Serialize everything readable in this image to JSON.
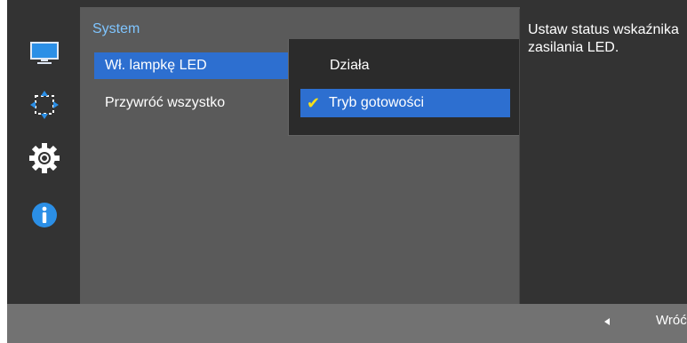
{
  "panel": {
    "title": "System",
    "items": [
      {
        "label": "Wł. lampkę LED",
        "selected": true
      },
      {
        "label": "Przywróć wszystko",
        "selected": false
      }
    ]
  },
  "submenu": {
    "options": [
      {
        "label": "Działa",
        "selected": false
      },
      {
        "label": "Tryb gotowości",
        "selected": true
      }
    ],
    "check_glyph": "✔"
  },
  "help": {
    "text": "Ustaw status wskaźnika zasilania LED."
  },
  "footer": {
    "back_label": "Wróć"
  },
  "icons": [
    {
      "name": "picture-icon",
      "color": "#2b8fe6"
    },
    {
      "name": "onscreen-display-icon",
      "color": "#2b8fe6"
    },
    {
      "name": "system-settings-icon",
      "color": "#ffffff"
    },
    {
      "name": "information-icon",
      "color": "#2b8fe6"
    }
  ],
  "colors": {
    "accent": "#2d6fd0",
    "title": "#7fc5ff",
    "check": "#f6df1a"
  }
}
